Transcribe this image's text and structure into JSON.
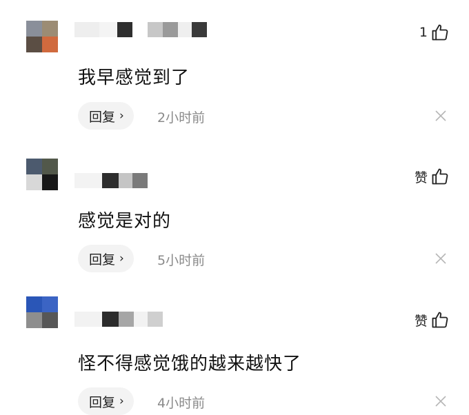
{
  "comments": [
    {
      "avatar": [
        "#8a8f9a",
        "#9c8c74",
        "#5b4e44",
        "#d06a3e"
      ],
      "name_blocks": [
        "#eeeeee",
        "#f4f4f4",
        "#2f2f2f",
        "#ffffff",
        "#c7c7c7",
        "#9a9a9a",
        "#efefef",
        "#3a3a3a"
      ],
      "likes": "1",
      "text": "我早感觉到了",
      "reply_label": "回复",
      "time": "2小时前"
    },
    {
      "avatar": [
        "#4c5a6e",
        "#52584a",
        "#d8d8d8",
        "#181818"
      ],
      "name_blocks": [
        "#f3f3f3",
        "#2d2d2d",
        "#c5c5c5",
        "#7a7a7a"
      ],
      "likes": "赞",
      "text": "感觉是对的",
      "reply_label": "回复",
      "time": "5小时前"
    },
    {
      "avatar": [
        "#2a56b7",
        "#3b64c4",
        "#8e8e8e",
        "#575757"
      ],
      "name_blocks": [
        "#f2f2f2",
        "#2b2b2b",
        "#a6a6a6",
        "#f2f2f2",
        "#cfcfcf"
      ],
      "likes": "赞",
      "text": "怪不得感觉饿的越来越快了",
      "reply_label": "回复",
      "time": "4小时前"
    }
  ]
}
